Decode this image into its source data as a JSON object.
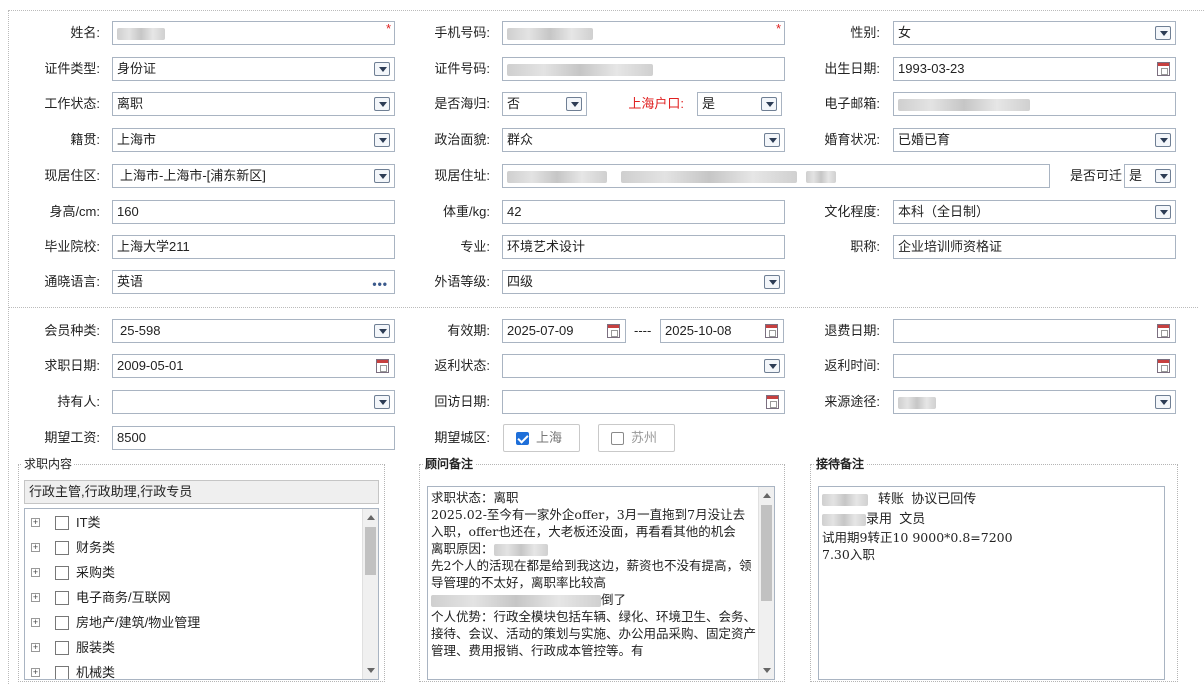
{
  "basic": {
    "name": {
      "label": "姓名:"
    },
    "phone": {
      "label": "手机号码:"
    },
    "gender": {
      "label": "性别:",
      "value": "女"
    },
    "id_type": {
      "label": "证件类型:",
      "value": "身份证"
    },
    "id_no": {
      "label": "证件号码:"
    },
    "birth": {
      "label": "出生日期:",
      "value": "1993-03-23"
    },
    "work_status": {
      "label": "工作状态:",
      "value": "离职"
    },
    "returnee": {
      "label": "是否海归:",
      "value": "否"
    },
    "hukou": {
      "label": "上海户口:",
      "value": "是"
    },
    "email": {
      "label": "电子邮箱:"
    },
    "native": {
      "label": "籍贯:",
      "value": "上海市"
    },
    "politics": {
      "label": "政治面貌:",
      "value": "群众"
    },
    "marital": {
      "label": "婚育状况:",
      "value": "已婚已育"
    },
    "residence_area": {
      "label": "现居住区:",
      "value": "上海市-上海市-[浦东新区]"
    },
    "residence_addr": {
      "label": "现居住址:"
    },
    "relocate": {
      "label": "是否可迁",
      "value": "是"
    },
    "height": {
      "label": "身高/cm:",
      "value": "160"
    },
    "weight": {
      "label": "体重/kg:",
      "value": "42"
    },
    "education": {
      "label": "文化程度:",
      "value": "本科（全日制）"
    },
    "school": {
      "label": "毕业院校:",
      "value": "上海大学211"
    },
    "major": {
      "label": "专业:",
      "value": "环境艺术设计"
    },
    "title": {
      "label": "职称:",
      "value": "企业培训师资格证"
    },
    "language": {
      "label": "通晓语言:",
      "value": "英语"
    },
    "lang_level": {
      "label": "外语等级:",
      "value": "四级"
    },
    "required_mark": "*"
  },
  "membership": {
    "type": {
      "label": "会员种类:",
      "value": "25-598"
    },
    "validity": {
      "label": "有效期:",
      "from": "2025-07-09",
      "sep": "----",
      "to": "2025-10-08"
    },
    "refund_date": {
      "label": "退费日期:",
      "value": ""
    },
    "job_date": {
      "label": "求职日期:",
      "value": "2009-05-01"
    },
    "rebate_status": {
      "label": "返利状态:",
      "value": ""
    },
    "rebate_time": {
      "label": "返利时间:",
      "value": ""
    },
    "holder": {
      "label": "持有人:",
      "value": ""
    },
    "visit_date": {
      "label": "回访日期:",
      "value": ""
    },
    "source": {
      "label": "来源途径:"
    },
    "salary": {
      "label": "期望工资:",
      "value": "8500"
    },
    "city": {
      "label": "期望城区:",
      "options": [
        {
          "label": "上海",
          "checked": true
        },
        {
          "label": "苏州",
          "checked": false
        }
      ]
    }
  },
  "job_content": {
    "legend": "求职内容",
    "selected": "行政主管,行政助理,行政专员",
    "categories": [
      "IT类",
      "财务类",
      "采购类",
      "电子商务/互联网",
      "房地产/建筑/物业管理",
      "服装类",
      "机械类"
    ]
  },
  "advisor_notes": {
    "legend": "顾问备注",
    "lines": [
      "求职状态：离职",
      "2025.02-至今有一家外企offer，3月一直拖到7月没让去入职，offer也还在，大老板还没面，再看看其他的机会",
      "离职原因：",
      "先2个人的活现在都是给到我这边，薪资也不没有提高，领导管理的不太好，离职率比较高",
      "倒了",
      "个人优势：行政全模块包括车辆、绿化、环境卫生、会务、接待、会议、活动的策划与实施、办公用品采购、固定资产管理、费用报销、行政成本管控等。有"
    ]
  },
  "reception_notes": {
    "legend": "接待备注",
    "lines": [
      "转账  协议已回传",
      "",
      "录用  文员",
      "试用期9转正10 9000*0.8=7200",
      "7.30入职"
    ]
  }
}
